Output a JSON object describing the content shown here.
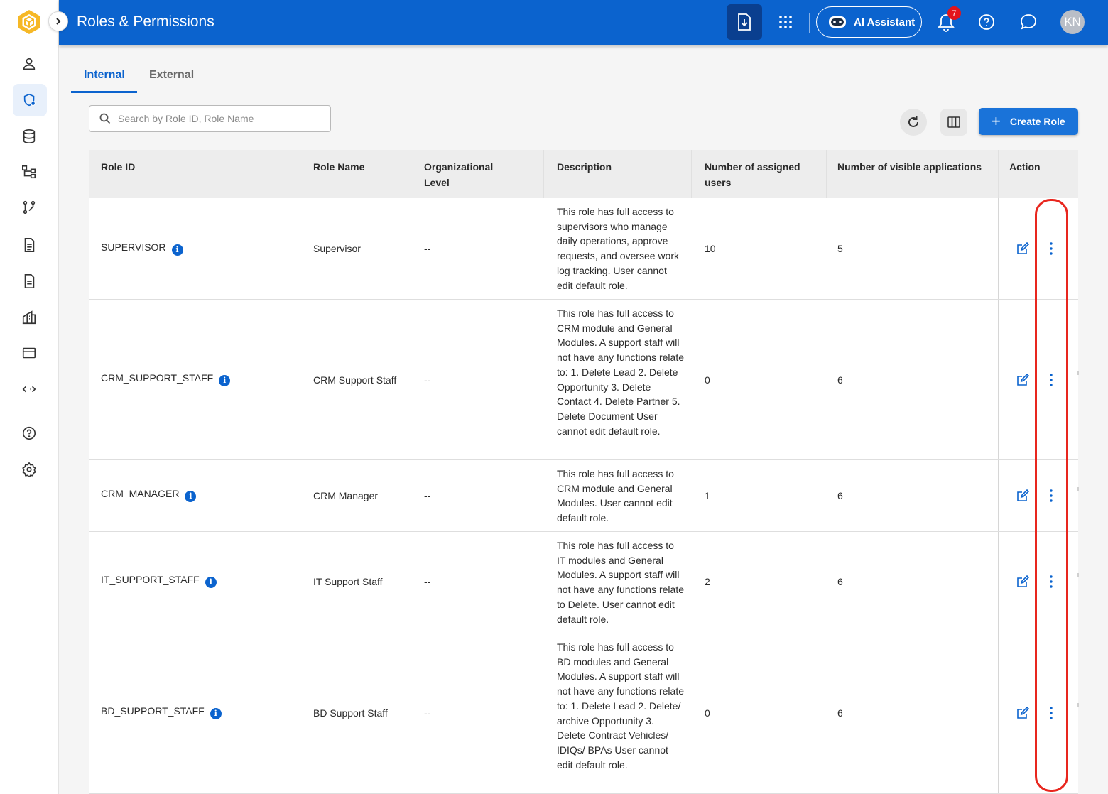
{
  "app": {
    "title": "Roles & Permissions"
  },
  "topbar": {
    "ai_label": "AI Assistant",
    "notification_count": "7",
    "avatar_initials": "KN"
  },
  "sidebar": {
    "items": [
      {
        "name": "person-icon"
      },
      {
        "name": "shield-role-icon",
        "active": true
      },
      {
        "name": "database-icon"
      },
      {
        "name": "hierarchy-icon"
      },
      {
        "name": "workflow-icon"
      },
      {
        "name": "document-icon"
      },
      {
        "name": "document-list-icon"
      },
      {
        "name": "building-icon"
      },
      {
        "name": "credit-card-icon"
      },
      {
        "name": "code-arrows-icon"
      },
      {
        "name": "help-circle-icon"
      },
      {
        "name": "settings-gear-icon"
      }
    ]
  },
  "tabs": [
    {
      "label": "Internal",
      "active": true
    },
    {
      "label": "External",
      "active": false
    }
  ],
  "search": {
    "placeholder": "Search by Role ID, Role Name",
    "value": ""
  },
  "toolbar": {
    "create_label": "Create Role",
    "create_plus": "+"
  },
  "table": {
    "headers": {
      "role_id": "Role ID",
      "role_name": "Role Name",
      "org_level_1": "Organizational",
      "org_level_2": "Level",
      "description": "Description",
      "assigned_1": "Number of assigned",
      "assigned_2": "users",
      "visible_apps": "Number of visible applications",
      "action": "Action"
    },
    "rows": [
      {
        "role_id": "SUPERVISOR",
        "role_name": "Supervisor",
        "org_level": "--",
        "description": "This role has full access to supervisors who manage daily operations, approve requests, and oversee work log tracking. User cannot edit default role.",
        "assigned_users": "10",
        "visible_apps": "5"
      },
      {
        "role_id": "CRM_SUPPORT_STAFF",
        "role_name": "CRM Support Staff",
        "org_level": "--",
        "description": "This role has full access to CRM module and General Modules. A support staff will not have any functions relate to: 1. Delete Lead 2. Delete Opportunity 3. Delete Contact 4. Delete Partner 5. Delete Document User cannot edit default role.",
        "assigned_users": "0",
        "visible_apps": "6"
      },
      {
        "role_id": "CRM_MANAGER",
        "role_name": "CRM Manager",
        "org_level": "--",
        "description": "This role has full access to CRM module and General Modules. User cannot edit default role.",
        "assigned_users": "1",
        "visible_apps": "6"
      },
      {
        "role_id": "IT_SUPPORT_STAFF",
        "role_name": "IT Support Staff",
        "org_level": "--",
        "description": "This role has full access to IT modules and General Modules. A support staff will not have any functions relate to Delete. User cannot edit default role.",
        "assigned_users": "2",
        "visible_apps": "6"
      },
      {
        "role_id": "BD_SUPPORT_STAFF",
        "role_name": "BD Support Staff",
        "org_level": "--",
        "description": "This role has full access to BD modules and General Modules. A support staff will not have any functions relate to: 1. Delete Lead 2. Delete/ archive Opportunity 3. Delete Contract Vehicles/ IDIQs/ BPAs User cannot edit default role.",
        "assigned_users": "0",
        "visible_apps": "6"
      }
    ]
  },
  "colors": {
    "primary": "#0b63ce",
    "highlight": "#e8261e",
    "badge": "#e3141b"
  }
}
